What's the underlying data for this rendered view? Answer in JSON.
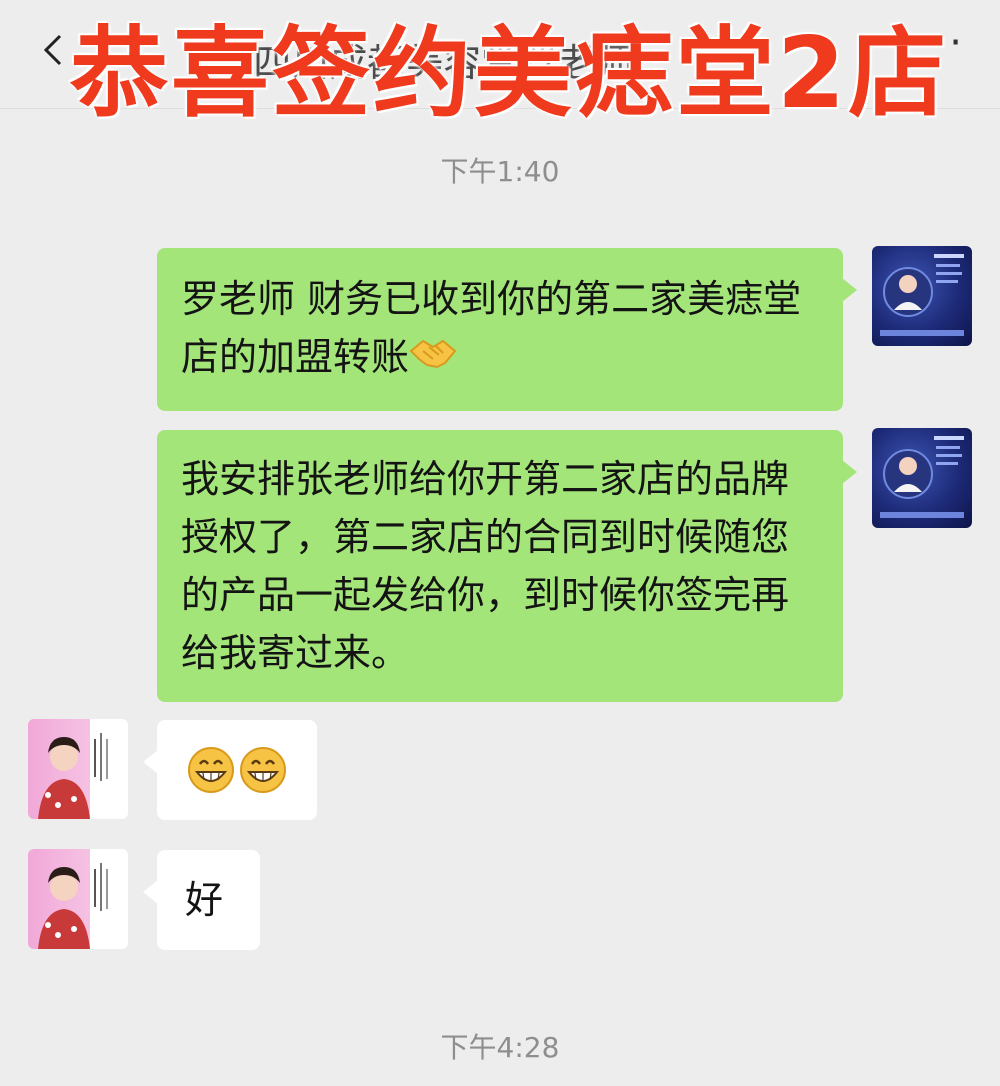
{
  "header": {
    "title": "Y四川成都美容堂罗老师",
    "more": "···"
  },
  "banner": {
    "text": "恭喜签约美痣堂2店"
  },
  "timestamps": [
    "下午1:40",
    "下午4:28"
  ],
  "messages": [
    {
      "side": "right",
      "text": "罗老师  财务已收到你的第二家美痣堂店的加盟转账",
      "emoji": "handshake-emoji"
    },
    {
      "side": "right",
      "text": "我安排张老师给你开第二家店的品牌授权了，第二家店的合同到时候随您的产品一起发给你，到时候你签完再给我寄过来。"
    },
    {
      "side": "left",
      "emoji": "grin-emoji"
    },
    {
      "side": "left",
      "text": "好"
    }
  ],
  "avatars": {
    "left_label": "罗老师"
  },
  "colors": {
    "banner": "#f03a1e",
    "green_bubble": "#a4e57a",
    "background": "#ededed"
  }
}
